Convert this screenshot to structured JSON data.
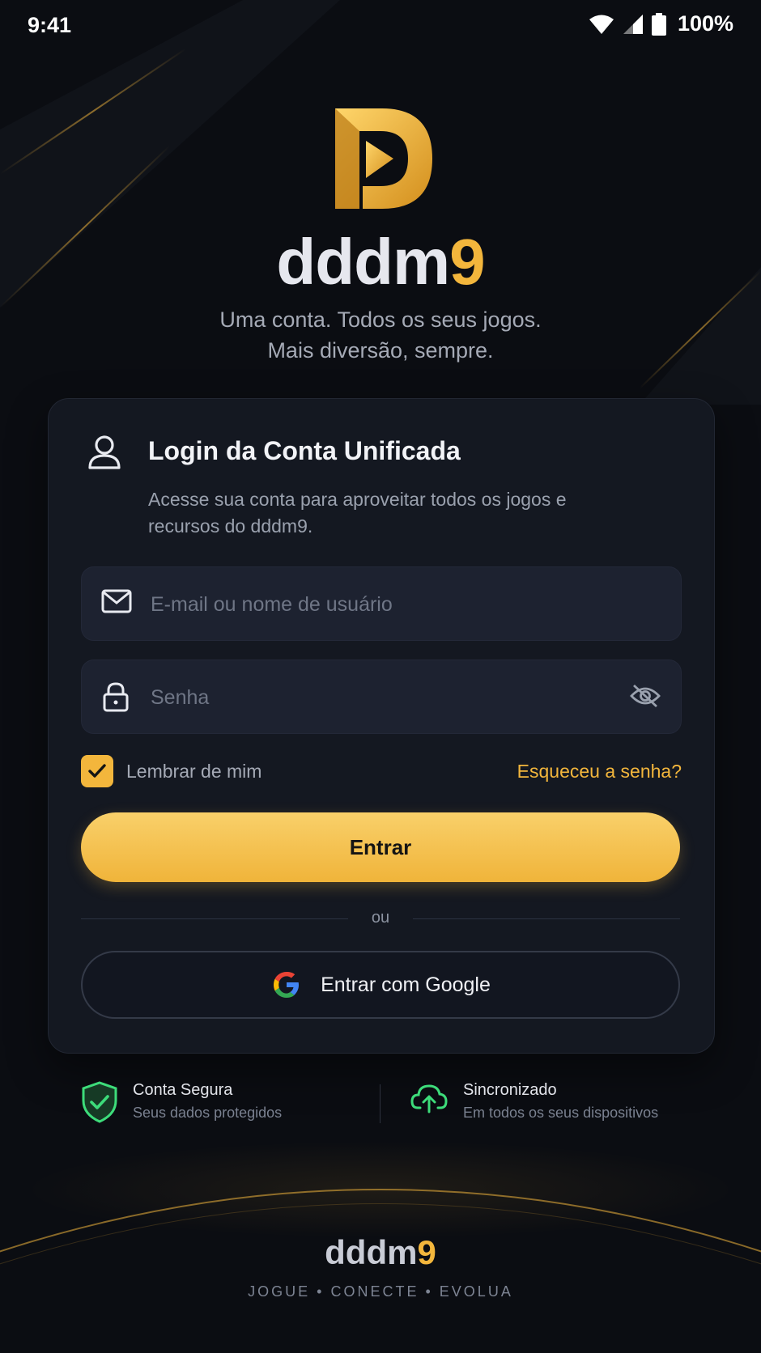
{
  "status_bar": {
    "time": "9:41",
    "battery_text": "100%"
  },
  "brand": {
    "name_main": "dddm",
    "name_accent": "9"
  },
  "tagline": {
    "line1": "Uma conta. Todos os seus jogos.",
    "line2": "Mais diversão, sempre."
  },
  "card": {
    "title": "Login da Conta Unificada",
    "subtitle": "Acesse sua conta para aproveitar todos os jogos e recursos do dddm9.",
    "email_placeholder": "E-mail ou nome de usuário",
    "password_placeholder": "Senha",
    "remember_label": "Lembrar de mim",
    "remember_checked": true,
    "forgot_label": "Esqueceu a senha?",
    "enter_label": "Entrar",
    "divider_text": "ou",
    "google_label": "Entrar com Google"
  },
  "features": [
    {
      "title": "Conta Segura",
      "subtitle": "Seus dados protegidos",
      "icon": "shield-check-icon"
    },
    {
      "title": "Sincronizado",
      "subtitle": "Em todos os seus dispositivos",
      "icon": "cloud-upload-icon"
    }
  ],
  "footer": {
    "brand_main": "dddm",
    "brand_accent": "9",
    "tagline": "JOGUE • CONECTE • EVOLUA"
  },
  "colors": {
    "accent": "#f3b63c",
    "background": "#0b0d12",
    "card": "#141821",
    "success": "#3ddc7a"
  }
}
